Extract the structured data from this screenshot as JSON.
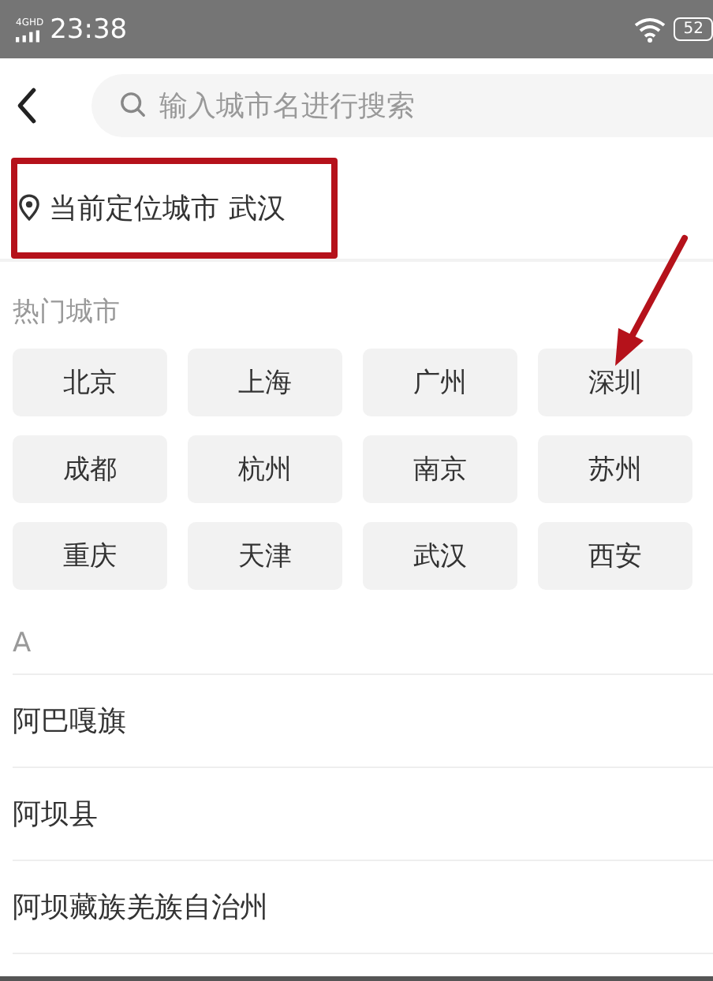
{
  "status_bar": {
    "network": "4GHD",
    "time": "23:38",
    "battery": "52"
  },
  "header": {
    "search": {
      "placeholder": "输入城市名进行搜索"
    }
  },
  "current_location": {
    "label": "当前定位城市",
    "city": "武汉"
  },
  "hot_cities": {
    "title": "热门城市",
    "cities": [
      "北京",
      "上海",
      "广州",
      "深圳",
      "成都",
      "杭州",
      "南京",
      "苏州",
      "重庆",
      "天津",
      "武汉",
      "西安"
    ]
  },
  "sections": [
    {
      "letter": "A",
      "cities": [
        "阿巴嘎旗",
        "阿坝县",
        "阿坝藏族羌族自治州"
      ]
    }
  ]
}
